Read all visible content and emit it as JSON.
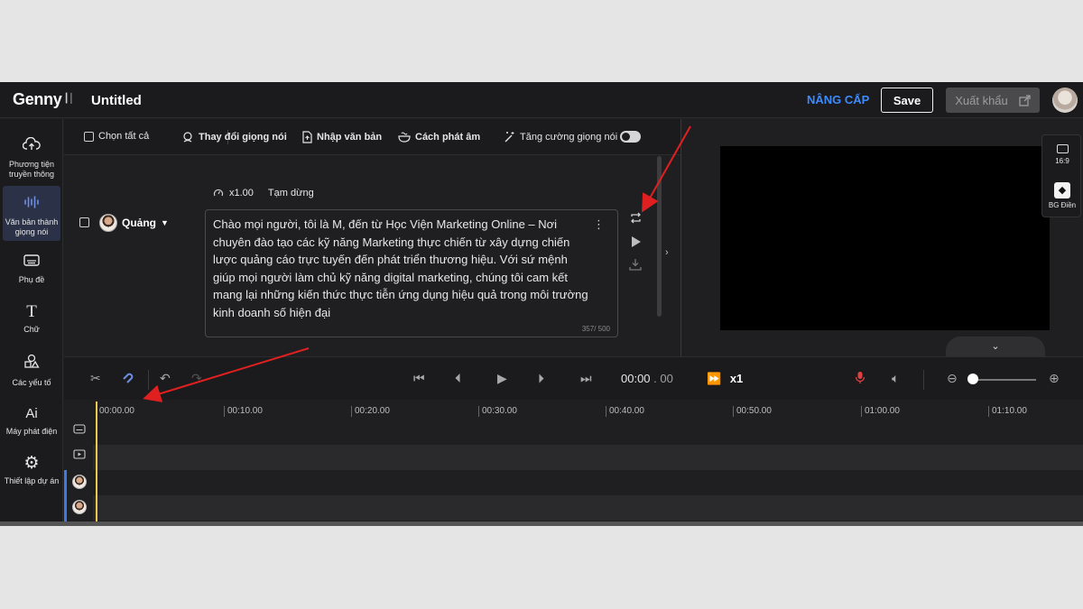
{
  "header": {
    "logo": "Genny",
    "logo_wave": "┃│",
    "project_title": "Untitled",
    "upgrade_label": "NÂNG CẤP",
    "save_label": "Save",
    "export_label": "Xuất khẩu"
  },
  "sidebar": {
    "items": [
      {
        "icon": "cloud-upload-icon",
        "glyph": "☁",
        "label": "Phương tiện truyền thông"
      },
      {
        "icon": "soundwave-icon",
        "glyph": "│┃│",
        "label": "Văn bản thành giọng nói",
        "active": true
      },
      {
        "icon": "subtitle-icon",
        "glyph": "▭",
        "label": "Phụ đề"
      },
      {
        "icon": "text-icon",
        "glyph": "T",
        "label": "Chữ"
      },
      {
        "icon": "shapes-icon",
        "glyph": "♢",
        "label": "Các yếu tố"
      },
      {
        "icon": "ai-icon",
        "glyph": "Ai",
        "label": "Máy phát điện"
      },
      {
        "icon": "settings-icon",
        "glyph": "⚙",
        "label": "Thiết lập dự án"
      }
    ]
  },
  "toolbar": {
    "select_all": "Chọn tất cả",
    "change_voice": "Thay đổi giọng nói",
    "import_text": "Nhập văn bản",
    "pronunciation": "Cách phát âm",
    "enhance_voice": "Tăng cường giọng nói",
    "enhance_enabled": true
  },
  "script": {
    "speed": "x1.00",
    "pause_label": "Tạm dừng",
    "speaker_name": "Quảng",
    "text": "Chào mọi người, tôi là M, đến từ Học Viện Marketing Online – Nơi chuyên đào tạo các kỹ năng Marketing thực chiến từ xây dựng chiến lược quảng cáo trực tuyến đến phát triển thương hiệu. Với sứ mệnh giúp mọi người làm chủ kỹ năng digital marketing, chúng tôi cam kết mang lại những kiến thức thực tiễn ứng dụng hiệu quả trong môi trường kinh doanh số hiện đại",
    "char_count": "357/ 500"
  },
  "preview": {
    "ratio_label": "16:9",
    "bg_label": "BG Điền"
  },
  "timeline": {
    "current_time": "00:00",
    "current_ms": ". 00",
    "speed": "x1",
    "ticks": [
      "00:00.00",
      "00:10.00",
      "00:20.00",
      "00:30.00",
      "00:40.00",
      "00:50.00",
      "01:00.00",
      "01:10.00"
    ]
  },
  "colors": {
    "accent_blue": "#3d8bfd",
    "playhead": "#f2c94c",
    "mic_red": "#e04040",
    "annotation_red": "#e02020"
  }
}
